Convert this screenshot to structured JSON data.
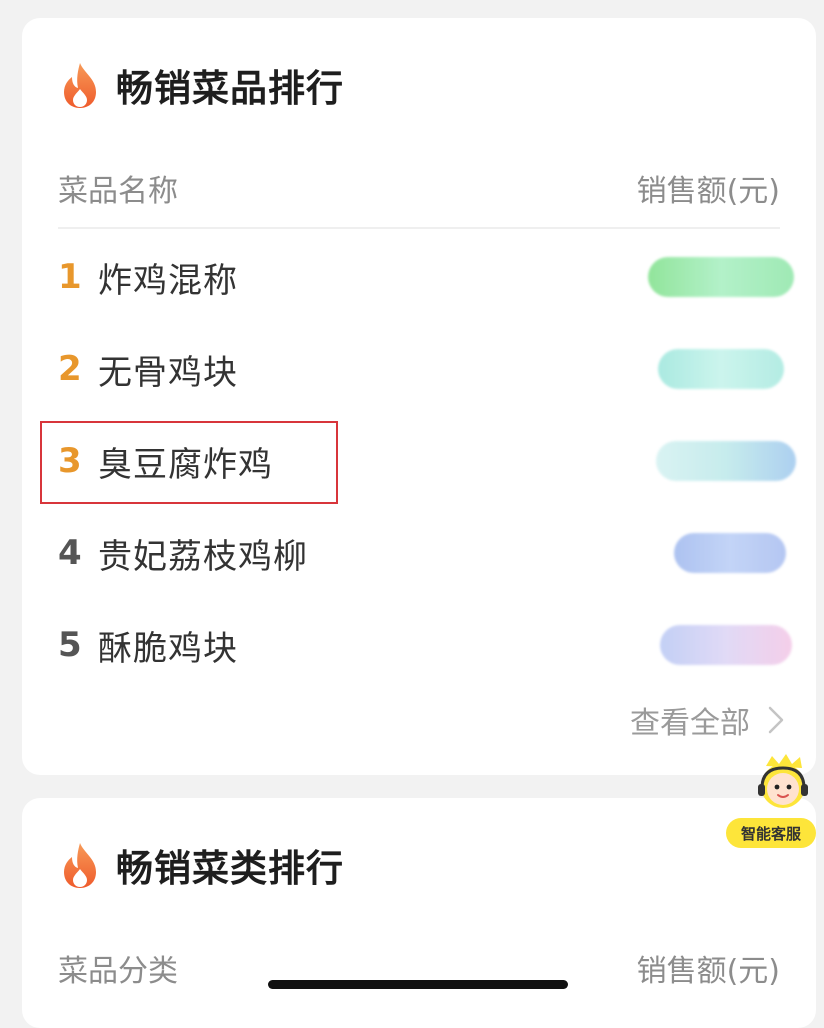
{
  "bestselling_dishes": {
    "title": "畅销菜品排行",
    "header_name": "菜品名称",
    "header_amount": "销售额(元)",
    "items": [
      {
        "rank": "1",
        "name": "炸鸡混称",
        "amount_colors": [
          "#7fe08a",
          "#a6efc0"
        ]
      },
      {
        "rank": "2",
        "name": "无骨鸡块",
        "amount_colors": [
          "#9ce6dc",
          "#c3f3ea"
        ]
      },
      {
        "rank": "3",
        "name": "臭豆腐炸鸡",
        "amount_colors": [
          "#bde9ea",
          "#9fc8ee"
        ]
      },
      {
        "rank": "4",
        "name": "贵妃荔枝鸡柳",
        "amount_colors": [
          "#9fb8ee",
          "#b9cdf6"
        ]
      },
      {
        "rank": "5",
        "name": "酥脆鸡块",
        "amount_colors": [
          "#b9c8f4",
          "#f3c6e6"
        ]
      }
    ],
    "view_all": "查看全部"
  },
  "bestselling_categories": {
    "title": "畅销菜类排行",
    "header_name": "菜品分类",
    "header_amount": "销售额(元)"
  },
  "assistant": {
    "label": "智能客服"
  },
  "colors": {
    "rank_top": "#e8972c",
    "rank_normal": "#555555",
    "highlight": "#d8353b",
    "fire": "#f47b3d"
  }
}
